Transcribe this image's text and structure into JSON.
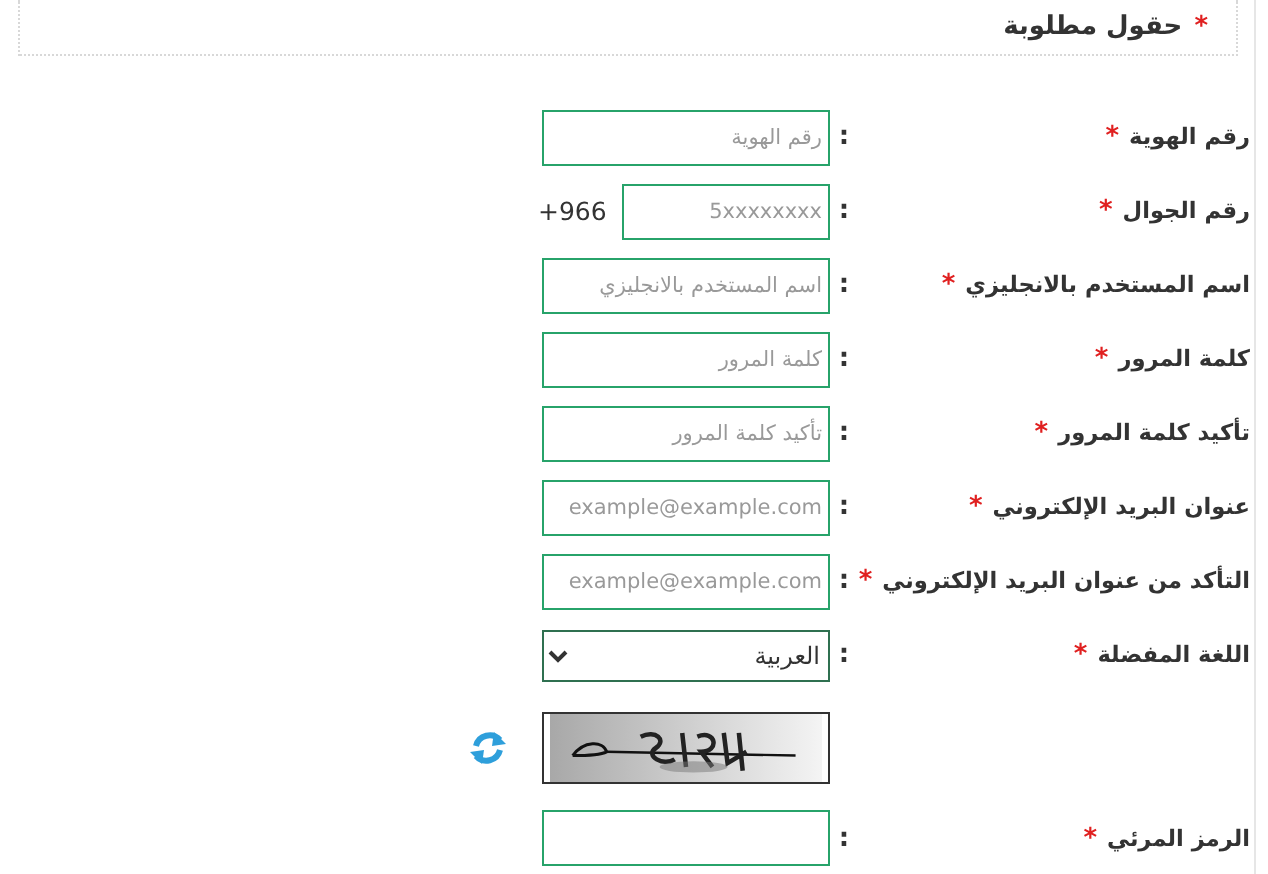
{
  "required_note": {
    "marker": "*",
    "text": "حقول مطلوبة"
  },
  "fields": [
    {
      "kind": "text",
      "label": "رقم الهوية",
      "marker": "*",
      "separator": ":",
      "placeholder": "رقم الهوية"
    },
    {
      "kind": "phone",
      "label": "رقم الجوال",
      "marker": "*",
      "separator": ":",
      "prefix": "+966",
      "placeholder": "5xxxxxxxx"
    },
    {
      "kind": "text",
      "label": "اسم المستخدم بالانجليزي",
      "marker": "*",
      "separator": ":",
      "placeholder": "اسم المستخدم بالانجليزي"
    },
    {
      "kind": "password",
      "label": "كلمة المرور",
      "marker": "*",
      "separator": ":",
      "placeholder": "كلمة المرور"
    },
    {
      "kind": "password",
      "label": "تأكيد كلمة المرور",
      "marker": "*",
      "separator": ":",
      "placeholder": "تأكيد كلمة المرور"
    },
    {
      "kind": "text",
      "label": "عنوان البريد الإلكتروني",
      "marker": "*",
      "separator": ":",
      "placeholder": "example@example.com"
    },
    {
      "kind": "text",
      "label": "التأكد من عنوان البريد الإلكتروني",
      "marker": "*",
      "separator": ":",
      "placeholder": "example@example.com"
    },
    {
      "kind": "select",
      "label": "اللغة المفضلة",
      "marker": "*",
      "separator": ":",
      "value": "العربية"
    },
    {
      "kind": "captcha"
    },
    {
      "kind": "text",
      "label": "الرمز المرئي",
      "marker": "*",
      "separator": ":"
    }
  ]
}
